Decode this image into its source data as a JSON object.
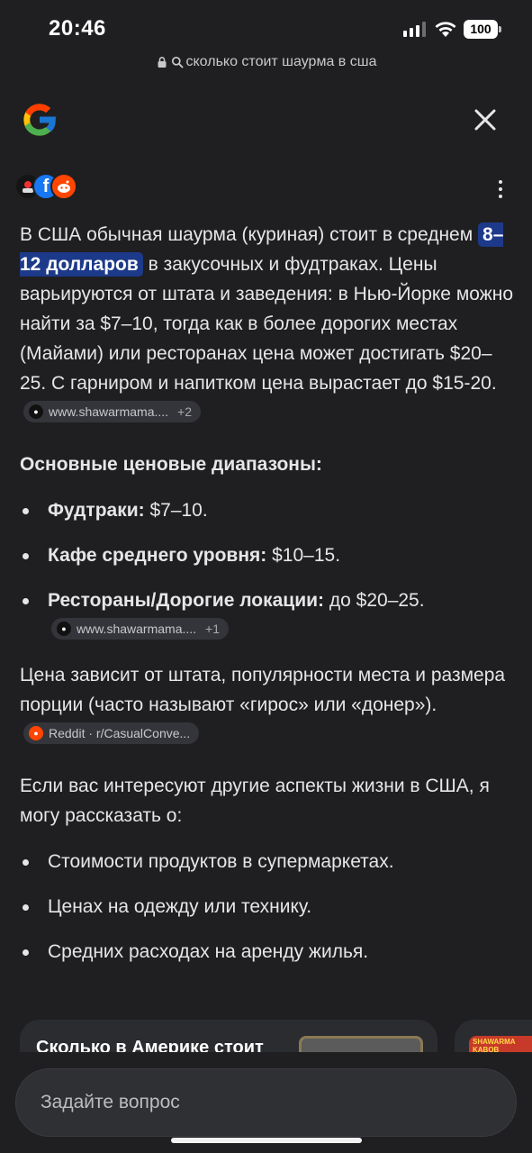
{
  "status_bar": {
    "time": "20:46",
    "battery": "100"
  },
  "url_bar": {
    "query": "сколько стоит шаурма в сша"
  },
  "sources_icons": [
    "source-1-avatar",
    "facebook-icon",
    "reddit-icon"
  ],
  "answer": {
    "intro_before": "В США обычная шаурма (куриная) стоит в среднем",
    "highlight": "8–12 долларов",
    "intro_after": "в закусочных и фудтраках. Цены варьируются от штата и заведения: в Нью-Йорке можно найти за $7–10, тогда как в более дорогих местах (Майами) или ресторанах цена может достигать $20–25. С гарниром и напитком цена вырастает до $15-20.",
    "chip1": {
      "label": "www.shawarmama....",
      "more": "+2"
    },
    "section_title": "Основные ценовые диапазоны:",
    "ranges": [
      {
        "label": "Фудтраки:",
        "value": "$7–10."
      },
      {
        "label": "Кафе среднего уровня:",
        "value": "$10–15."
      },
      {
        "label": "Рестораны/Дорогие локации:",
        "value": "до $20–25."
      }
    ],
    "chip2": {
      "label": "www.shawarmama....",
      "more": "+1"
    },
    "note": "Цена зависит от штата, популярности места и размера порции (часто называют «гирос» или «донер»).",
    "chip3": {
      "label": "Reddit · r/CasualConve..."
    },
    "followup_intro": "Если вас интересуют другие аспекты жизни в США, я могу рассказать о:",
    "followups": [
      "Стоимости продуктов в супермаркетах.",
      "Ценах на одежду или технику.",
      "Средних расходах на аренду жилья."
    ]
  },
  "cards": {
    "card1_title": "Сколько в Америке стоит",
    "card2_badge": "SHAWARMA KABOB"
  },
  "ask": {
    "placeholder": "Задайте вопрос"
  },
  "colors": {
    "background": "#1f1f21",
    "highlight": "#1d3a8a",
    "chip": "#34353a"
  }
}
